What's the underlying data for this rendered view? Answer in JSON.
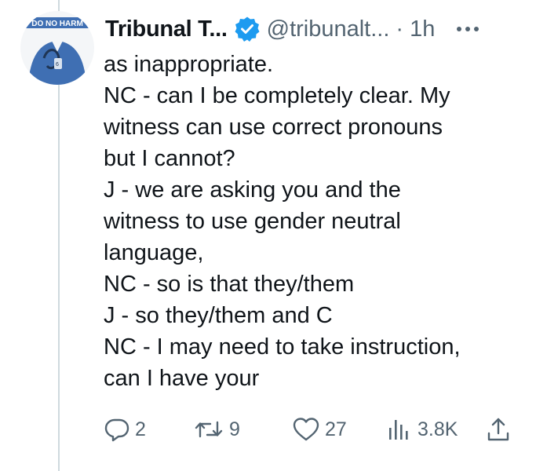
{
  "tweet": {
    "display_name": "Tribunal T...",
    "handle": "@tribunalt...",
    "separator": "·",
    "time": "1h",
    "avatar_text": "DO NO HARM",
    "lines": [
      "as inappropriate.",
      "NC - can I be completely clear.  My",
      "witness can use correct pronouns",
      "but I cannot?",
      "J - we are asking you and the",
      "witness to use gender neutral",
      "language,",
      "NC - so is that they/them",
      "J - so they/them and C",
      "NC - I may need to take instruction,",
      "can I have your"
    ]
  },
  "actions": {
    "replies": "2",
    "retweets": "9",
    "likes": "27",
    "views": "3.8K"
  },
  "colors": {
    "verified_badge": "#1d9bf0",
    "muted_text": "#536471",
    "thread_line": "#cfd9de",
    "avatar_shirt": "#3f6fb3"
  },
  "icons": {
    "verified": "verified-badge-icon",
    "more": "more-dots-icon",
    "reply": "reply-bubble-icon",
    "retweet": "retweet-icon",
    "like": "heart-icon",
    "views": "views-bars-icon",
    "share": "share-upload-icon"
  }
}
